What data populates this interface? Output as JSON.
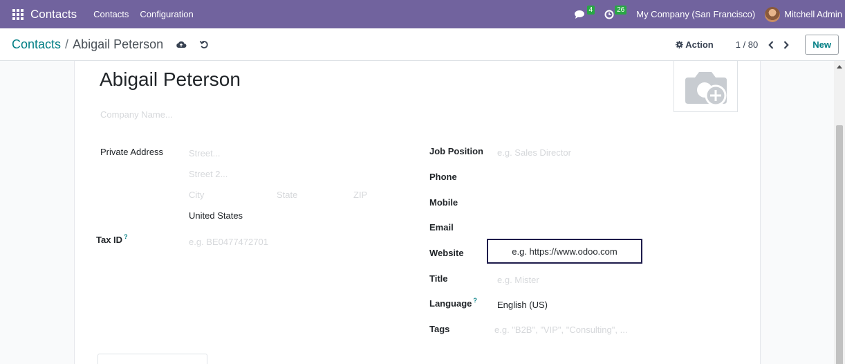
{
  "navbar": {
    "app_name": "Contacts",
    "menu": [
      "Contacts",
      "Configuration"
    ],
    "messages_count": "4",
    "activities_count": "26",
    "company": "My Company (San Francisco)",
    "user": "Mitchell Admin"
  },
  "control": {
    "breadcrumb_parent": "Contacts",
    "breadcrumb_sep": "/",
    "breadcrumb_current": "Abigail Peterson",
    "action_label": "Action",
    "pager": "1 / 80",
    "new_label": "New"
  },
  "form": {
    "name": "Abigail Peterson",
    "company_placeholder": "Company Name...",
    "private_address_label": "Private Address",
    "street_placeholder": "Street...",
    "street2_placeholder": "Street 2...",
    "city_placeholder": "City",
    "state_placeholder": "State",
    "zip_placeholder": "ZIP",
    "country": "United States",
    "tax_id_label": "Tax ID",
    "help_mark": "?",
    "tax_id_placeholder": "e.g. BE0477472701",
    "job_position_label": "Job Position",
    "job_position_placeholder": "e.g. Sales Director",
    "phone_label": "Phone",
    "mobile_label": "Mobile",
    "email_label": "Email",
    "website_label": "Website",
    "website_placeholder": "e.g. https://www.odoo.com",
    "title_label": "Title",
    "title_placeholder": "e.g. Mister",
    "language_label": "Language",
    "language_value": "English (US)",
    "tags_label": "Tags",
    "tags_placeholder": "e.g. \"B2B\", \"VIP\", \"Consulting\", ..."
  },
  "colors": {
    "navbar": "#71639e",
    "accent": "#017e84",
    "badge": "#28a745"
  }
}
